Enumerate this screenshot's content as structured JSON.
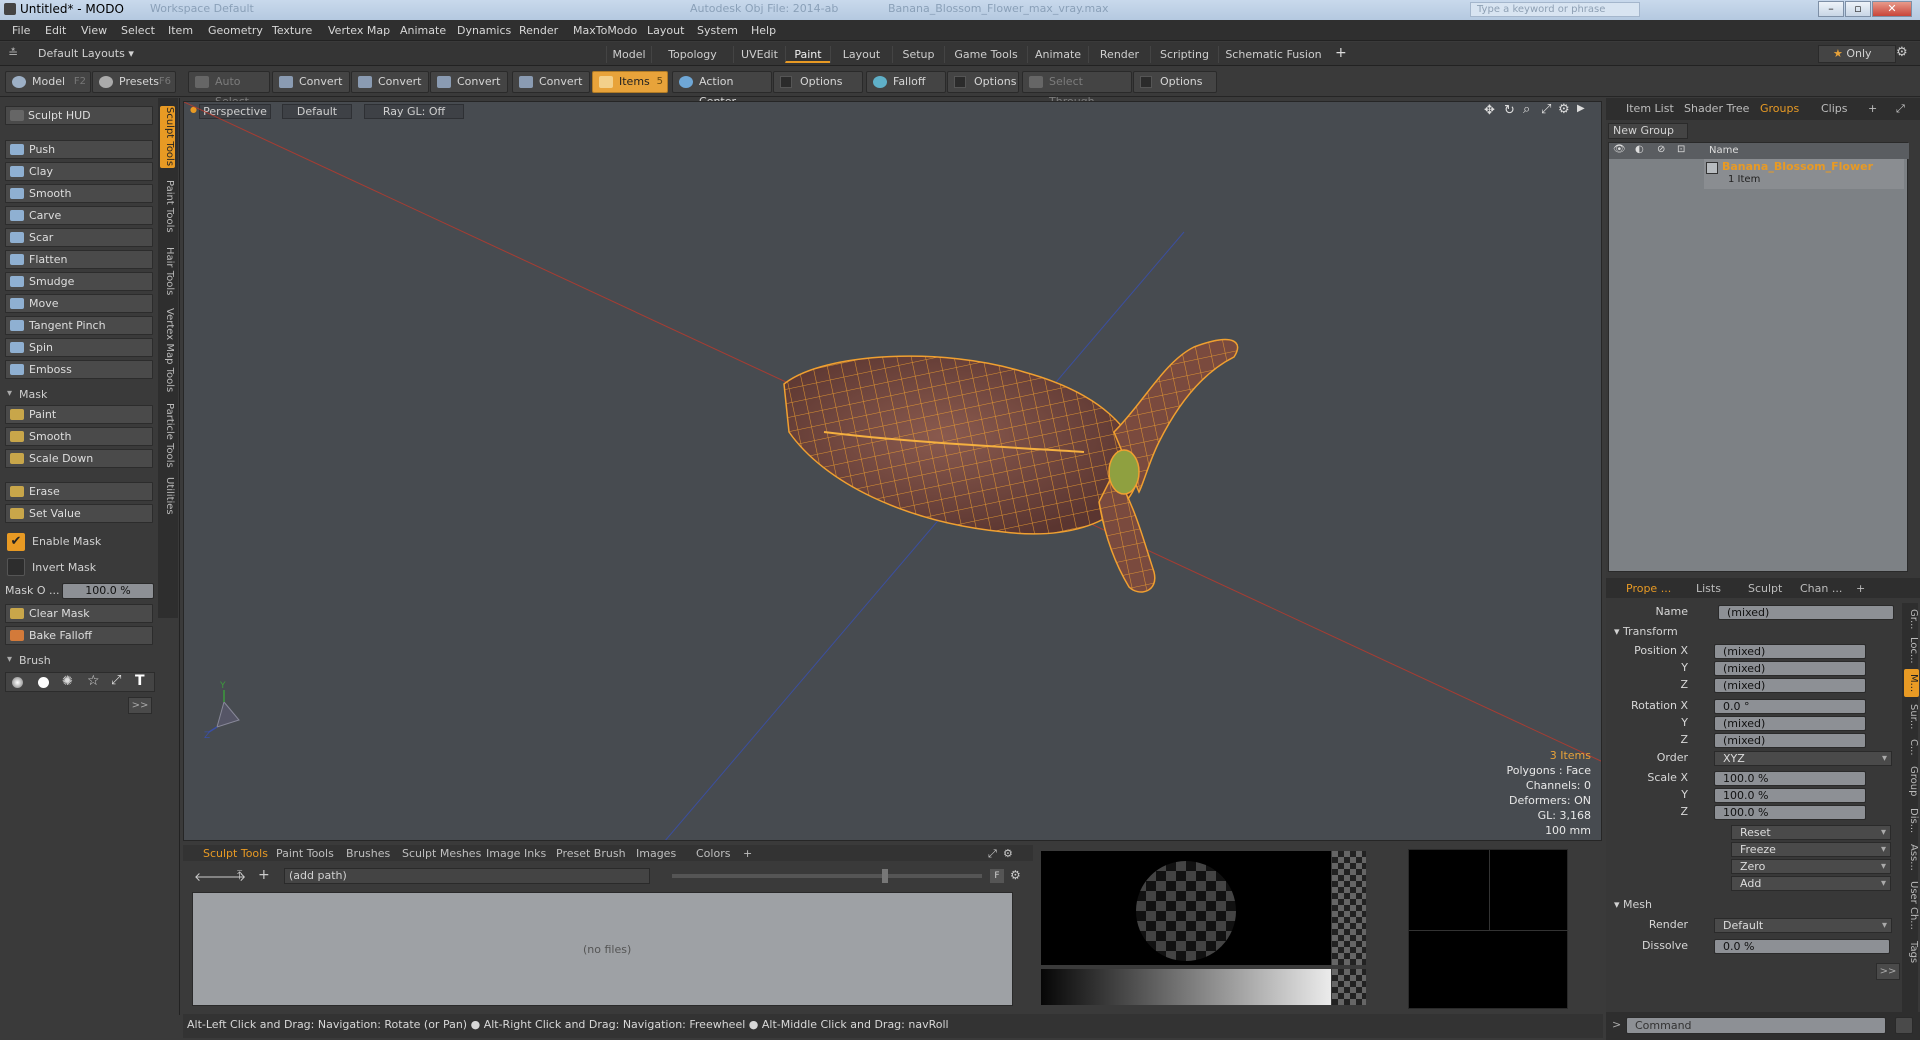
{
  "window": {
    "title": "Untitled* - MODO",
    "ghost_tab": "Workspace Default",
    "ghost_center": "Autodesk Obj File: 2014-ab",
    "ghost_file": "Banana_Blossom_Flower_max_vray.max",
    "search_placeholder": "Type a keyword or phrase"
  },
  "menu": [
    "File",
    "Edit",
    "View",
    "Select",
    "Item",
    "Geometry",
    "Texture",
    "Vertex Map",
    "Animate",
    "Dynamics",
    "Render",
    "MaxToModo",
    "Layout",
    "System",
    "Help"
  ],
  "layouts": {
    "label": "Default Layouts",
    "tabs": [
      "Model",
      "Topology",
      "UVEdit",
      "Paint",
      "Layout",
      "Setup",
      "Game Tools",
      "Animate",
      "Render",
      "Scripting",
      "Schematic Fusion"
    ],
    "active": "Paint",
    "add": "+",
    "only": "Only"
  },
  "toolbar": {
    "model": "Model",
    "model_key": "F2",
    "presets": "Presets",
    "presets_key": "F6",
    "auto_select": "Auto Select",
    "convert1": "Convert",
    "convert2": "Convert",
    "convert3": "Convert",
    "convert4": "Convert",
    "items": "Items",
    "items_key": "5",
    "action_center": "Action Center",
    "options1": "Options",
    "falloff": "Falloff",
    "options2": "Options",
    "select_through": "Select Through",
    "options3": "Options"
  },
  "left": {
    "hud": "Sculpt HUD",
    "tools": [
      "Push",
      "Clay",
      "Smooth",
      "Carve",
      "Scar",
      "Flatten",
      "Smudge",
      "Move",
      "Tangent Pinch",
      "Spin",
      "Emboss"
    ],
    "mask_section": "Mask",
    "mask_tools": [
      "Paint",
      "Smooth",
      "Scale Down"
    ],
    "erase": "Erase",
    "set_value": "Set Value",
    "enable_mask": "Enable Mask",
    "invert_mask": "Invert Mask",
    "mask_opacity_label": "Mask O ...",
    "mask_opacity_value": "100.0 %",
    "clear_mask": "Clear Mask",
    "bake_falloff": "Bake Falloff",
    "brush_section": "Brush",
    "more": ">>",
    "vtabs": [
      "Sculpt Tools",
      "Paint Tools",
      "Hair Tools",
      "Vertex Map Tools",
      "Particle Tools",
      "Utilities"
    ]
  },
  "viewport": {
    "view": "Perspective",
    "shading": "Default",
    "raygl": "Ray GL: Off",
    "info": [
      "3 Items",
      "Polygons : Face",
      "Channels: 0",
      "Deformers: ON",
      "GL: 3,168",
      "100 mm"
    ]
  },
  "bottom": {
    "tabs": [
      "Sculpt Tools",
      "Paint Tools",
      "Brushes",
      "Sculpt Meshes",
      "Image Inks",
      "Preset Brush",
      "Images",
      "Colors",
      "+"
    ],
    "path_placeholder": "(add path)",
    "no_files": "(no files)",
    "f": "F"
  },
  "status": "Alt-Left Click and Drag: Navigation: Rotate (or Pan) ● Alt-Right Click and Drag: Navigation: Freewheel ● Alt-Middle Click and Drag: navRoll",
  "right_top": {
    "tabs": [
      "Item List",
      "Shader Tree",
      "Groups",
      "Clips",
      "+"
    ],
    "active": "Groups",
    "new_group": "New Group",
    "col_name": "Name",
    "group_name": "Banana_Blossom_Flower",
    "group_count": "1 Item"
  },
  "props": {
    "tabs": [
      "Prope ...",
      "Lists",
      "Sculpt",
      "Chan ...",
      "+"
    ],
    "name_label": "Name",
    "name_value": "(mixed)",
    "transform": "Transform",
    "position": [
      {
        "l": "Position X",
        "v": "(mixed)"
      },
      {
        "l": "Y",
        "v": "(mixed)"
      },
      {
        "l": "Z",
        "v": "(mixed)"
      }
    ],
    "rotation": [
      {
        "l": "Rotation X",
        "v": "0.0 °"
      },
      {
        "l": "Y",
        "v": "(mixed)"
      },
      {
        "l": "Z",
        "v": "(mixed)"
      }
    ],
    "order_label": "Order",
    "order_value": "XYZ",
    "scale": [
      {
        "l": "Scale X",
        "v": "100.0 %"
      },
      {
        "l": "Y",
        "v": "100.0 %"
      },
      {
        "l": "Z",
        "v": "100.0 %"
      }
    ],
    "actions": [
      "Reset",
      "Freeze",
      "Zero",
      "Add"
    ],
    "mesh": "Mesh",
    "render_label": "Render",
    "render_value": "Default",
    "dissolve_label": "Dissolve",
    "dissolve_value": "0.0 %",
    "more": ">>",
    "side_tabs": [
      "Gr...",
      "Loc...",
      "M...",
      "Sur...",
      "C...",
      "Group",
      "Dis...",
      "Ass...",
      "User Ch...",
      "Tags"
    ],
    "command_placeholder": "Command"
  },
  "colors": {
    "accent": "#e89a24",
    "mesh_wire": "#f0a030",
    "axis_x": "#c0392b",
    "axis_z": "#3a4fa8"
  }
}
